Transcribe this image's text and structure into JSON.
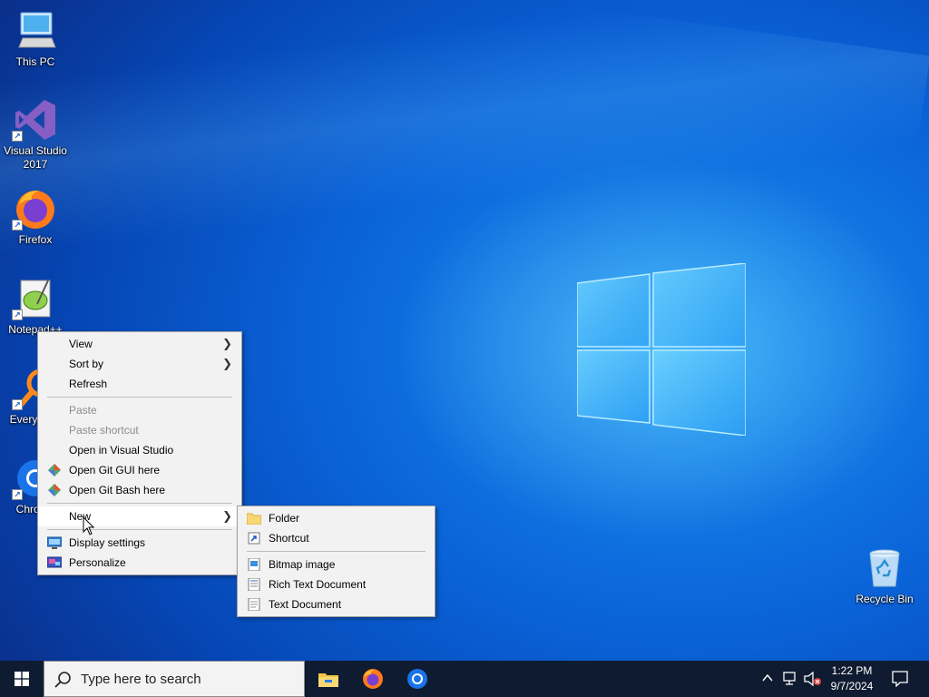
{
  "desktop_icons": [
    {
      "label": "This PC",
      "icon": "this-pc-icon"
    },
    {
      "label": "Visual Studio 2017",
      "icon": "visual-studio-icon"
    },
    {
      "label": "Firefox",
      "icon": "firefox-icon"
    },
    {
      "label": "Notepad++",
      "icon": "notepadpp-icon"
    },
    {
      "label": "Everything",
      "icon": "everything-icon"
    },
    {
      "label": "Chrome",
      "icon": "chrome-icon"
    },
    {
      "label": "Recycle Bin",
      "icon": "recycle-bin-icon"
    }
  ],
  "context_menu": {
    "view": "View",
    "sort_by": "Sort by",
    "refresh": "Refresh",
    "paste": "Paste",
    "paste_shortcut": "Paste shortcut",
    "open_vs": "Open in Visual Studio",
    "open_git_gui": "Open Git GUI here",
    "open_git_bash": "Open Git Bash here",
    "new": "New",
    "display_settings": "Display settings",
    "personalize": "Personalize"
  },
  "new_submenu": {
    "folder": "Folder",
    "shortcut": "Shortcut",
    "bitmap": "Bitmap image",
    "rtf": "Rich Text Document",
    "text": "Text Document"
  },
  "taskbar": {
    "search_placeholder": "Type here to search",
    "time": "1:22 PM",
    "date": "9/7/2024",
    "pinned": [
      "file-explorer-icon",
      "firefox-icon",
      "chrome-icon"
    ]
  },
  "colors": {
    "taskbar": "#0f1b30",
    "menu_bg": "#f2f2f2",
    "accent": "#0a63d8"
  }
}
